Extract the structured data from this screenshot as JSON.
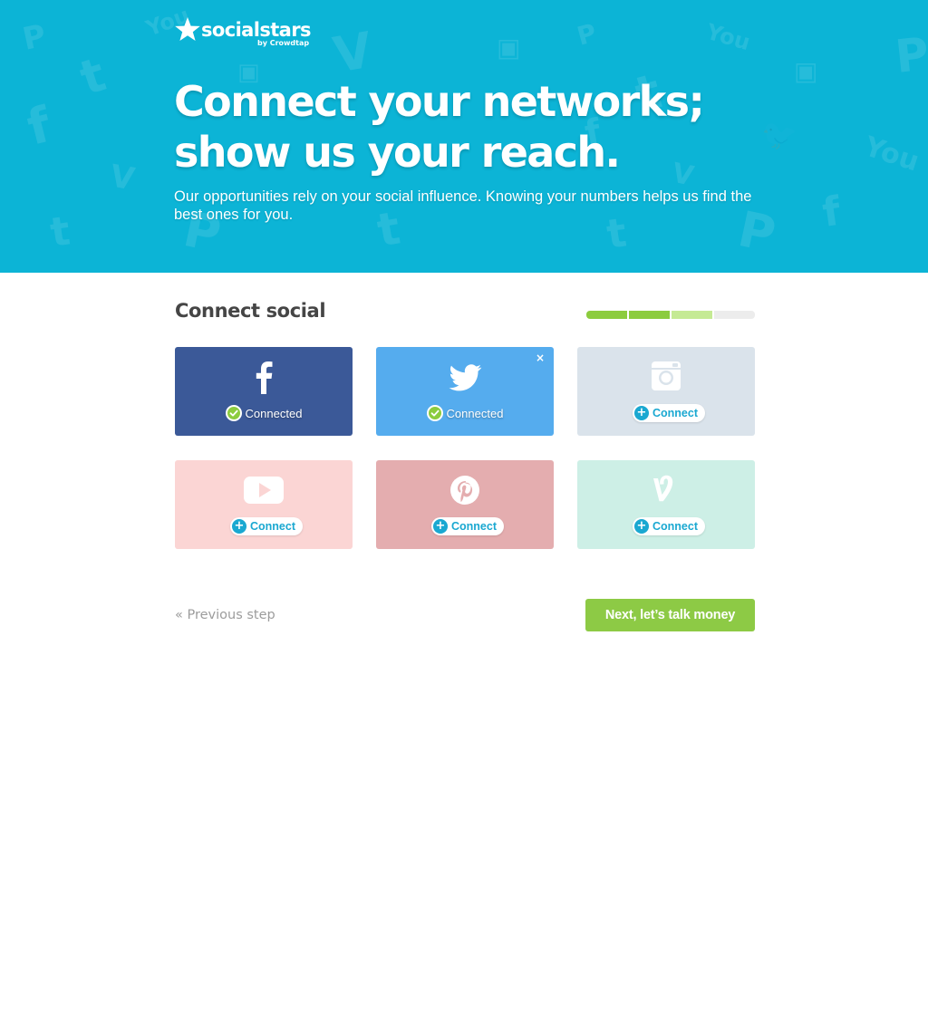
{
  "brand": {
    "name": "socialstars",
    "byline": "by Crowdtap",
    "colors": {
      "hero": "#0cb4d6",
      "accent_green": "#8dca45",
      "connect_blue": "#1aa8d1"
    }
  },
  "hero": {
    "title_line1": "Connect your networks;",
    "title_line2": "show us your reach.",
    "subtitle": "Our opportunities rely on your social influence. Knowing your numbers helps us find the best ones for you."
  },
  "section": {
    "title": "Connect social"
  },
  "progress": {
    "steps_total": 4,
    "segments": [
      {
        "state": "complete",
        "color": "#8ccc3e"
      },
      {
        "state": "complete",
        "color": "#8ccc3e"
      },
      {
        "state": "current",
        "color": "#c5ea94"
      },
      {
        "state": "upcoming",
        "color": "#ececec"
      }
    ]
  },
  "networks": [
    {
      "id": "facebook",
      "icon": "facebook-icon",
      "status": "connected",
      "status_label": "Connected",
      "color": "#3b5998",
      "removable": false
    },
    {
      "id": "twitter",
      "icon": "twitter-icon",
      "status": "connected",
      "status_label": "Connected",
      "color": "#55acee",
      "removable": true,
      "remove_label": "×"
    },
    {
      "id": "instagram",
      "icon": "instagram-icon",
      "status": "not-connected",
      "status_label": "Connect",
      "color": "#dae3eb",
      "removable": false
    },
    {
      "id": "youtube",
      "icon": "youtube-icon",
      "status": "not-connected",
      "status_label": "Connect",
      "color": "#fbd5d4",
      "removable": false
    },
    {
      "id": "pinterest",
      "icon": "pinterest-icon",
      "status": "not-connected",
      "status_label": "Connect",
      "color": "#e4adaf",
      "removable": false
    },
    {
      "id": "vine",
      "icon": "vine-icon",
      "status": "not-connected",
      "status_label": "Connect",
      "color": "#cdefe6",
      "removable": false
    }
  ],
  "nav": {
    "previous_label": "« Previous step",
    "next_label": "Next, let’s talk money"
  }
}
